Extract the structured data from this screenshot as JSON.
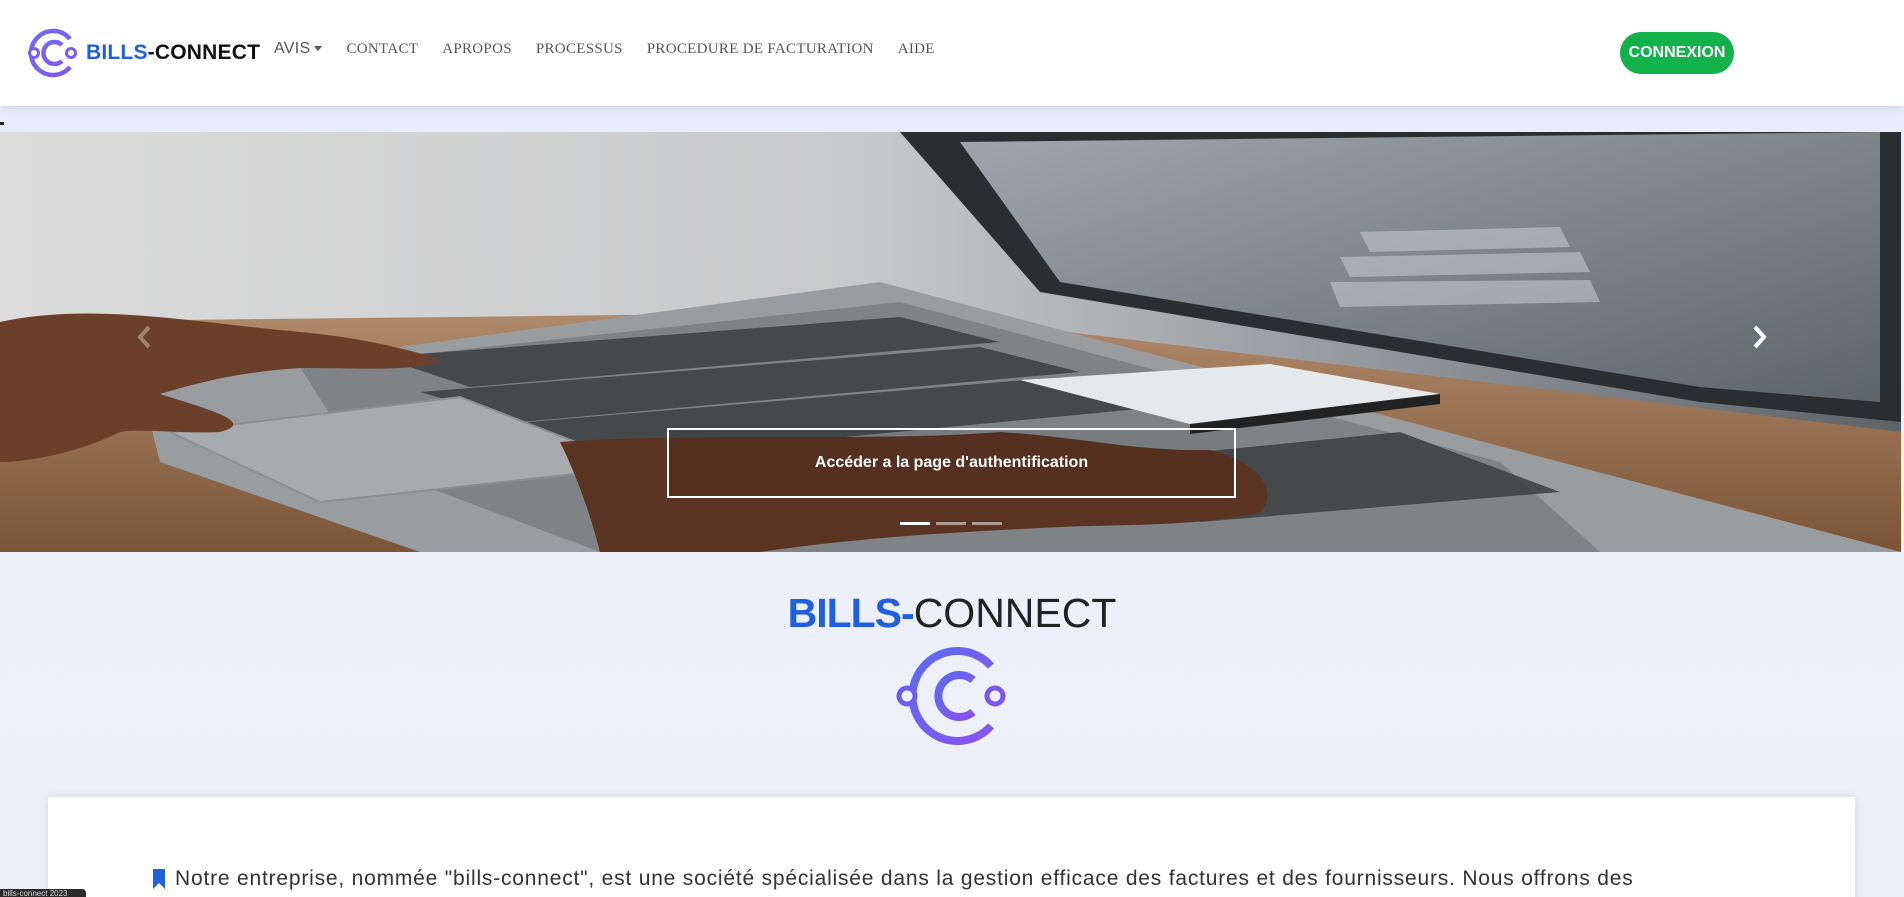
{
  "brand": {
    "name_part1": "BILLS",
    "name_part2": "-CONNECT"
  },
  "nav": {
    "items": [
      {
        "label": "AVIS",
        "has_dropdown": true
      },
      {
        "label": "CONTACT"
      },
      {
        "label": "APROPOS"
      },
      {
        "label": "PROCESSUS"
      },
      {
        "label": "PROCEDURE DE FACTURATION"
      },
      {
        "label": "AIDE"
      }
    ],
    "login_label": "CONNEXION"
  },
  "hero": {
    "auth_button_label": "Accéder a la page d'authentification",
    "slide_count": 3,
    "active_slide": 1
  },
  "section": {
    "title_part1": "BILLS-",
    "title_part2": "CONNECT"
  },
  "card": {
    "text": "Notre entreprise, nommée \"bills-connect\", est une société spécialisée dans la gestion efficace des factures et des fournisseurs. Nous offrons des"
  },
  "corner_tag": "bills-connect 2023",
  "colors": {
    "brand_blue": "#1f5fe0",
    "logo_purple": "#7b5cf0",
    "login_green": "#12b14a"
  }
}
